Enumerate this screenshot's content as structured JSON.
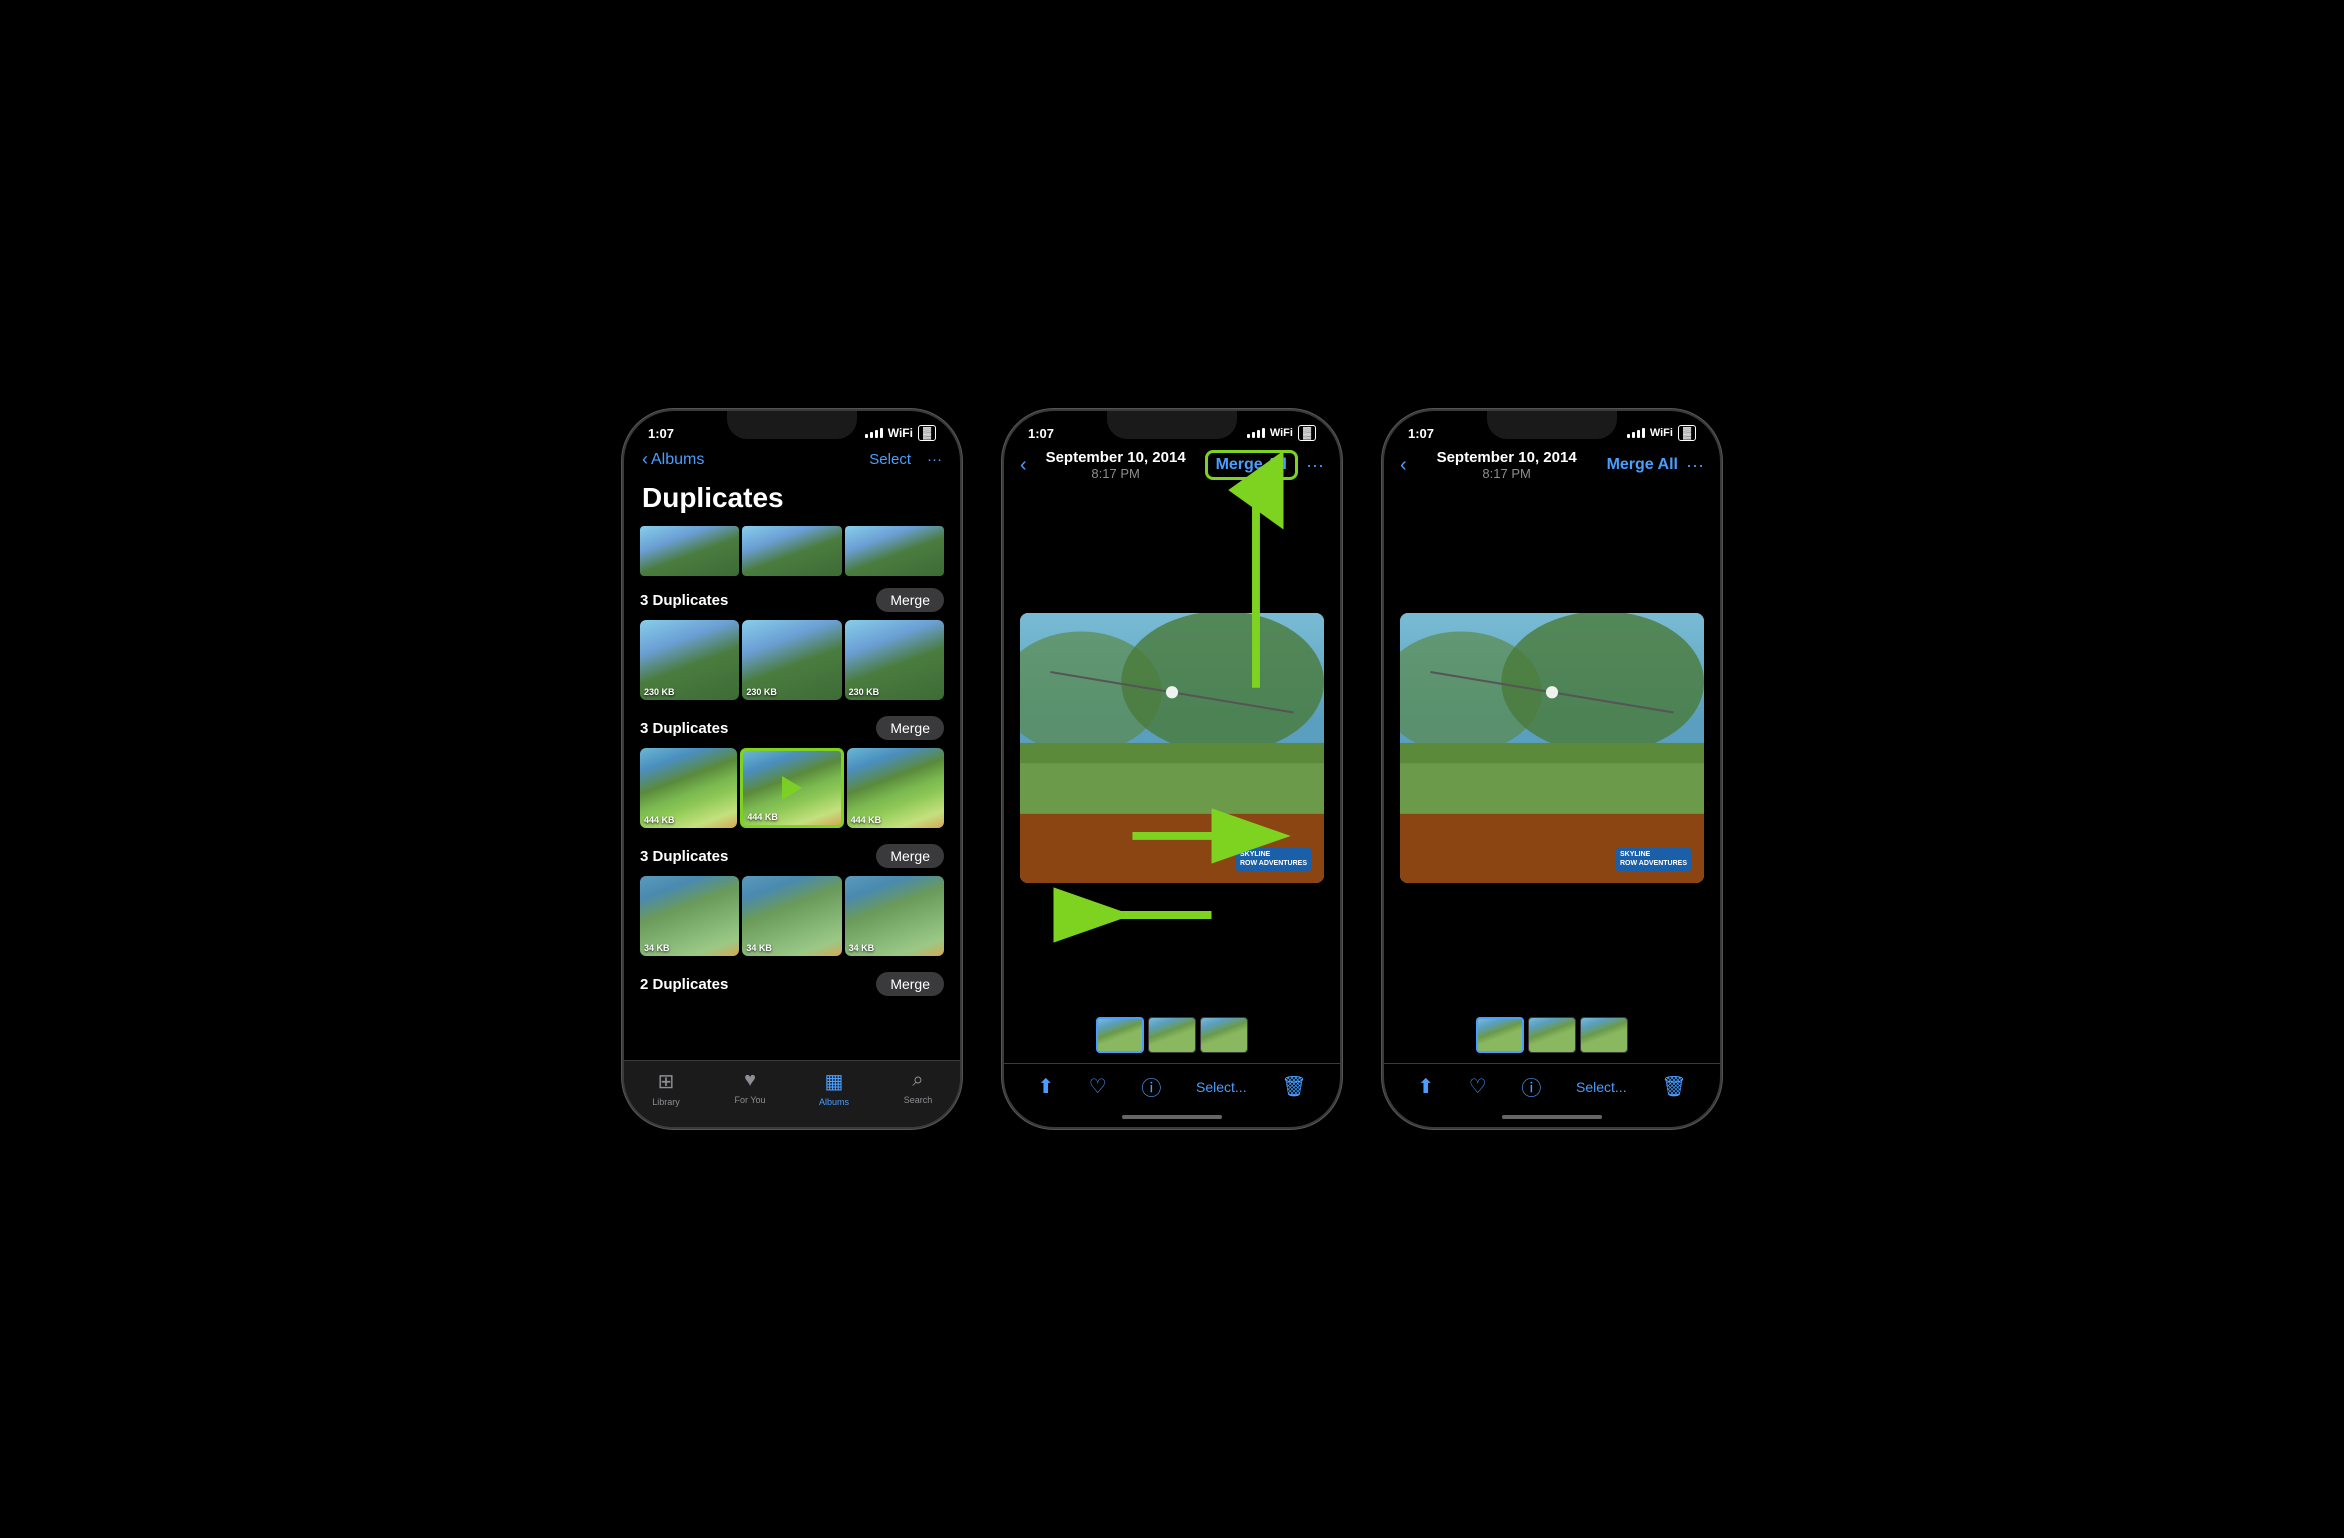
{
  "scene": {
    "background": "#000000"
  },
  "phone1": {
    "status_time": "1:07",
    "nav_back": "Albums",
    "nav_select": "Select",
    "nav_more": "···",
    "page_title": "Duplicates",
    "groups": [
      {
        "count_label": "3 Duplicates",
        "merge_label": "Merge",
        "photos": [
          {
            "size": "230 KB"
          },
          {
            "size": "230 KB"
          },
          {
            "size": "230 KB"
          }
        ]
      },
      {
        "count_label": "3 Duplicates",
        "merge_label": "Merge",
        "highlighted": 1,
        "photos": [
          {
            "size": "444 KB"
          },
          {
            "size": "444 KB"
          },
          {
            "size": "444 KB"
          }
        ]
      },
      {
        "count_label": "3 Duplicates",
        "merge_label": "Merge",
        "photos": [
          {
            "size": "34 KB"
          },
          {
            "size": "34 KB"
          },
          {
            "size": "34 KB"
          }
        ]
      },
      {
        "count_label": "2 Duplicates",
        "merge_label": "Merge",
        "photos": []
      }
    ],
    "tabs": [
      {
        "label": "Library",
        "icon": "⊞",
        "active": false
      },
      {
        "label": "For You",
        "icon": "♥",
        "active": false
      },
      {
        "label": "Albums",
        "icon": "▦",
        "active": true
      },
      {
        "label": "Search",
        "icon": "⌕",
        "active": false
      }
    ]
  },
  "phone2": {
    "status_time": "1:07",
    "nav_date": "September 10, 2014",
    "nav_time": "8:17 PM",
    "merge_all_label": "Merge All",
    "more_icon": "···",
    "skyline_badge": "SKYLINE\nROW ADVENTURES",
    "toolbar": {
      "share": "⬆",
      "heart": "♡",
      "info": "ⓘ",
      "select": "Select...",
      "delete": "🗑"
    }
  },
  "phone3": {
    "status_time": "1:07",
    "nav_date": "September 10, 2014",
    "nav_time": "8:17 PM",
    "merge_all_label": "Merge All",
    "more_icon": "···",
    "skyline_badge": "SKYLINE\nROW ADVENTURES",
    "toolbar": {
      "share": "⬆",
      "heart": "♡",
      "info": "ⓘ",
      "select": "Select...",
      "delete": "🗑"
    }
  }
}
